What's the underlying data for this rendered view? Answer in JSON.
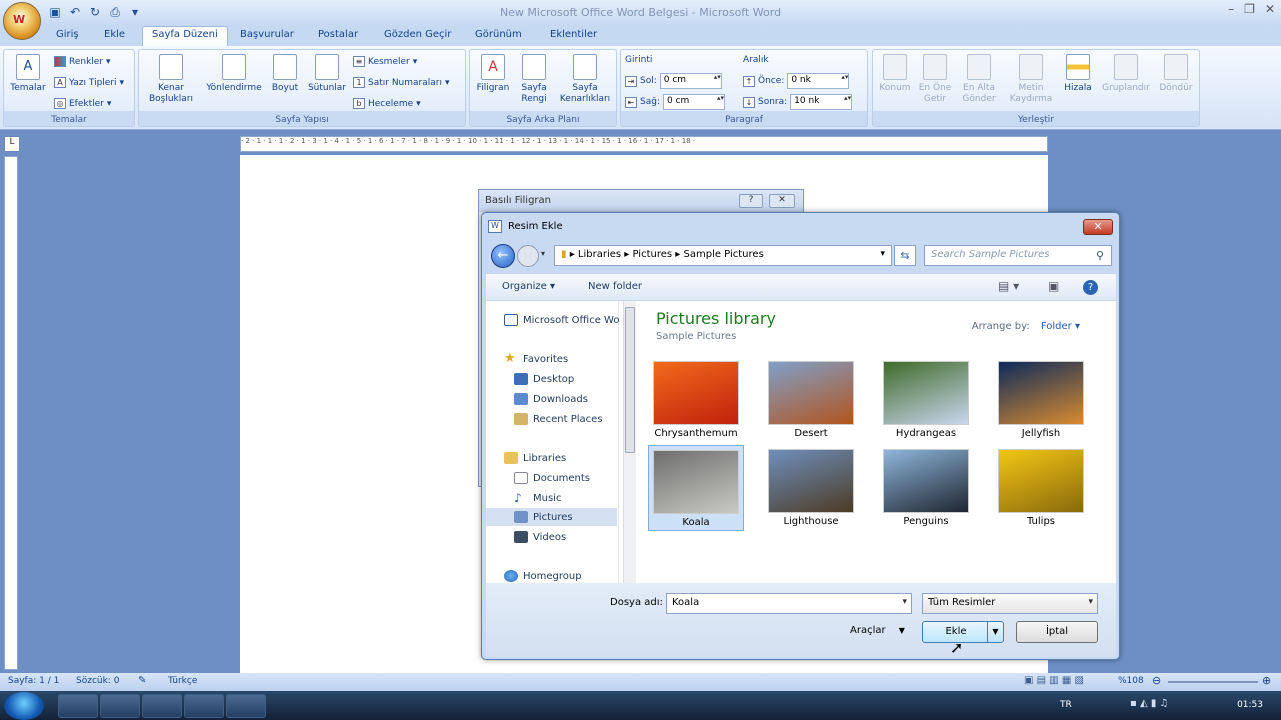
{
  "window": {
    "title": "New Microsoft Office Word Belgesi - Microsoft Word",
    "office_button": "Office"
  },
  "qat": [
    "save-icon",
    "undo-icon",
    "redo-icon",
    "print-icon",
    "customize-icon"
  ],
  "tabs": [
    "Giriş",
    "Ekle",
    "Sayfa Düzeni",
    "Başvurular",
    "Postalar",
    "Gözden Geçir",
    "Görünüm",
    "Eklentiler"
  ],
  "active_tab": "Sayfa Düzeni",
  "ribbon": {
    "temalar": {
      "label": "Temalar",
      "btn": "Temalar",
      "renkler": "Renkler",
      "yazi_tipleri": "Yazı Tipleri",
      "efektler": "Efektler"
    },
    "sayfa_yapisi": {
      "label": "Sayfa Yapısı",
      "kenar1": "Kenar",
      "kenar2": "Boşlukları",
      "yonlendirme": "Yönlendirme",
      "boyut": "Boyut",
      "sutunlar": "Sütunlar",
      "kesmeler": "Kesmeler",
      "satir_numaralari": "Satır Numaraları",
      "heceleme": "Heceleme"
    },
    "sayfa_arka": {
      "label": "Sayfa Arka Planı",
      "filigran": "Filigran",
      "renk1": "Sayfa",
      "renk2": "Rengi",
      "kenar1": "Sayfa",
      "kenar2": "Kenarlıkları"
    },
    "paragraf": {
      "label": "Paragraf",
      "girinti": "Girinti",
      "sol_label": "Sol:",
      "sol_value": "0 cm",
      "sag_label": "Sağ:",
      "sag_value": "0 cm",
      "aralik": "Aralık",
      "once_label": "Önce:",
      "once_value": "0 nk",
      "sonra_label": "Sonra:",
      "sonra_value": "10 nk"
    },
    "yerlestir": {
      "label": "Yerleştir",
      "konum": "Konum",
      "en_one1": "En Öne",
      "en_one2": "Getir",
      "en_alta1": "En Alta",
      "en_alta2": "Gönder",
      "metin1": "Metin",
      "metin2": "Kaydırma",
      "hizala": "Hizala",
      "gruplandir": "Gruplandır",
      "dondur": "Döndür"
    }
  },
  "ruler": "· 2 · 1 · 1 · 1 · 2 · 1 · 3 · 1 · 4 · 1 · 5 · 1 · 6 · 1 · 7 · 1 · 8 · 1 · 9 · 1 · 10 · 1 · 11 · 1 · 12 · 1 · 13 · 1 · 14 · 1 · 15 · 1 · 16 · 1 · 17 · 1 · 18 ·",
  "filigran_dialog": {
    "title": "Basılı Filigran",
    "help": "?",
    "close": "✕"
  },
  "resim_dialog": {
    "title": "Resim Ekle",
    "address": [
      "Libraries",
      "Pictures",
      "Sample Pictures"
    ],
    "search_placeholder": "Search Sample Pictures",
    "organize": "Organize",
    "new_folder": "New folder",
    "nav": {
      "top": "Microsoft Office Wo",
      "favorites": "Favorites",
      "desktop": "Desktop",
      "downloads": "Downloads",
      "recent": "Recent Places",
      "libraries": "Libraries",
      "documents": "Documents",
      "music": "Music",
      "pictures": "Pictures",
      "videos": "Videos",
      "homegroup": "Homegroup"
    },
    "library_title": "Pictures library",
    "library_sub": "Sample Pictures",
    "arrange_label": "Arrange by:",
    "arrange_value": "Folder",
    "images": [
      {
        "name": "Chrysanthemum",
        "colors": [
          "#f26a1c",
          "#c0210d"
        ]
      },
      {
        "name": "Desert",
        "colors": [
          "#7fa0c9",
          "#b3541d"
        ]
      },
      {
        "name": "Hydrangeas",
        "colors": [
          "#3f6b2a",
          "#c9d6ee"
        ]
      },
      {
        "name": "Jellyfish",
        "colors": [
          "#0d2a5b",
          "#d98b2f"
        ]
      },
      {
        "name": "Koala",
        "colors": [
          "#6e6e6e",
          "#c9c9c4"
        ]
      },
      {
        "name": "Lighthouse",
        "colors": [
          "#6f8fbd",
          "#4c3b24"
        ]
      },
      {
        "name": "Penguins",
        "colors": [
          "#8fb6dc",
          "#1e2630"
        ]
      },
      {
        "name": "Tulips",
        "colors": [
          "#f2c614",
          "#8a6a0c"
        ]
      }
    ],
    "selected": "Koala",
    "filename_label": "Dosya adı:",
    "filename_value": "Koala",
    "filter_value": "Tüm Resimler",
    "tools": "Araçlar",
    "insert": "Ekle",
    "cancel": "İptal"
  },
  "status": {
    "page": "Sayfa: 1 / 1",
    "words": "Sözcük: 0",
    "lang": "Türkçe",
    "zoom": "%108"
  },
  "taskbar": {
    "lang": "TR",
    "time": "01:53"
  }
}
